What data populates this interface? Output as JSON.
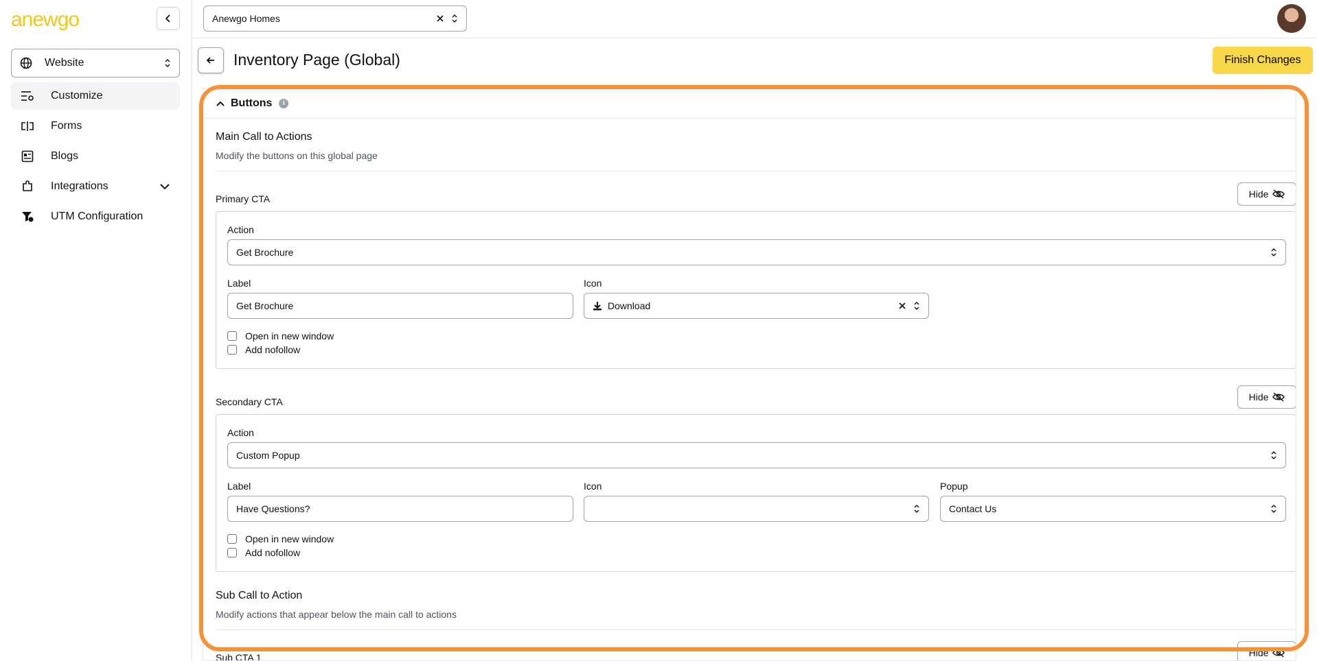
{
  "brand": {
    "logo_text": "anewgo",
    "accent": "#f5c518"
  },
  "sidebar": {
    "site_select": "Website",
    "items": [
      {
        "label": "Customize",
        "icon": "customize-icon",
        "active": true
      },
      {
        "label": "Forms",
        "icon": "forms-icon"
      },
      {
        "label": "Blogs",
        "icon": "blogs-icon"
      },
      {
        "label": "Integrations",
        "icon": "integrations-icon",
        "expandable": true
      },
      {
        "label": "UTM Configuration",
        "icon": "utm-icon"
      }
    ]
  },
  "topbar": {
    "builder": "Anewgo Homes"
  },
  "header": {
    "title": "Inventory Page (Global)",
    "finish_label": "Finish Changes",
    "finish_color": "#f9d64a"
  },
  "panel": {
    "title": "Buttons",
    "info": "i",
    "main": {
      "title": "Main Call to Actions",
      "desc": "Modify the buttons on this global page"
    },
    "primary": {
      "label": "Primary CTA",
      "hide": "Hide",
      "action_label": "Action",
      "action_value": "Get Brochure",
      "label_label": "Label",
      "label_value": "Get Brochure",
      "icon_label": "Icon",
      "icon_value": "Download",
      "open_new": "Open in new window",
      "nofollow": "Add nofollow"
    },
    "secondary": {
      "label": "Secondary CTA",
      "hide": "Hide",
      "action_label": "Action",
      "action_value": "Custom Popup",
      "label_label": "Label",
      "label_value": "Have Questions?",
      "icon_label": "Icon",
      "icon_value": "",
      "popup_label": "Popup",
      "popup_value": "Contact Us",
      "open_new": "Open in new window",
      "nofollow": "Add nofollow"
    },
    "sub": {
      "title": "Sub Call to Action",
      "desc": "Modify actions that appear below the main call to actions",
      "cta1": "Sub CTA 1",
      "hide": "Hide"
    }
  },
  "highlight_color": "#f7923a"
}
